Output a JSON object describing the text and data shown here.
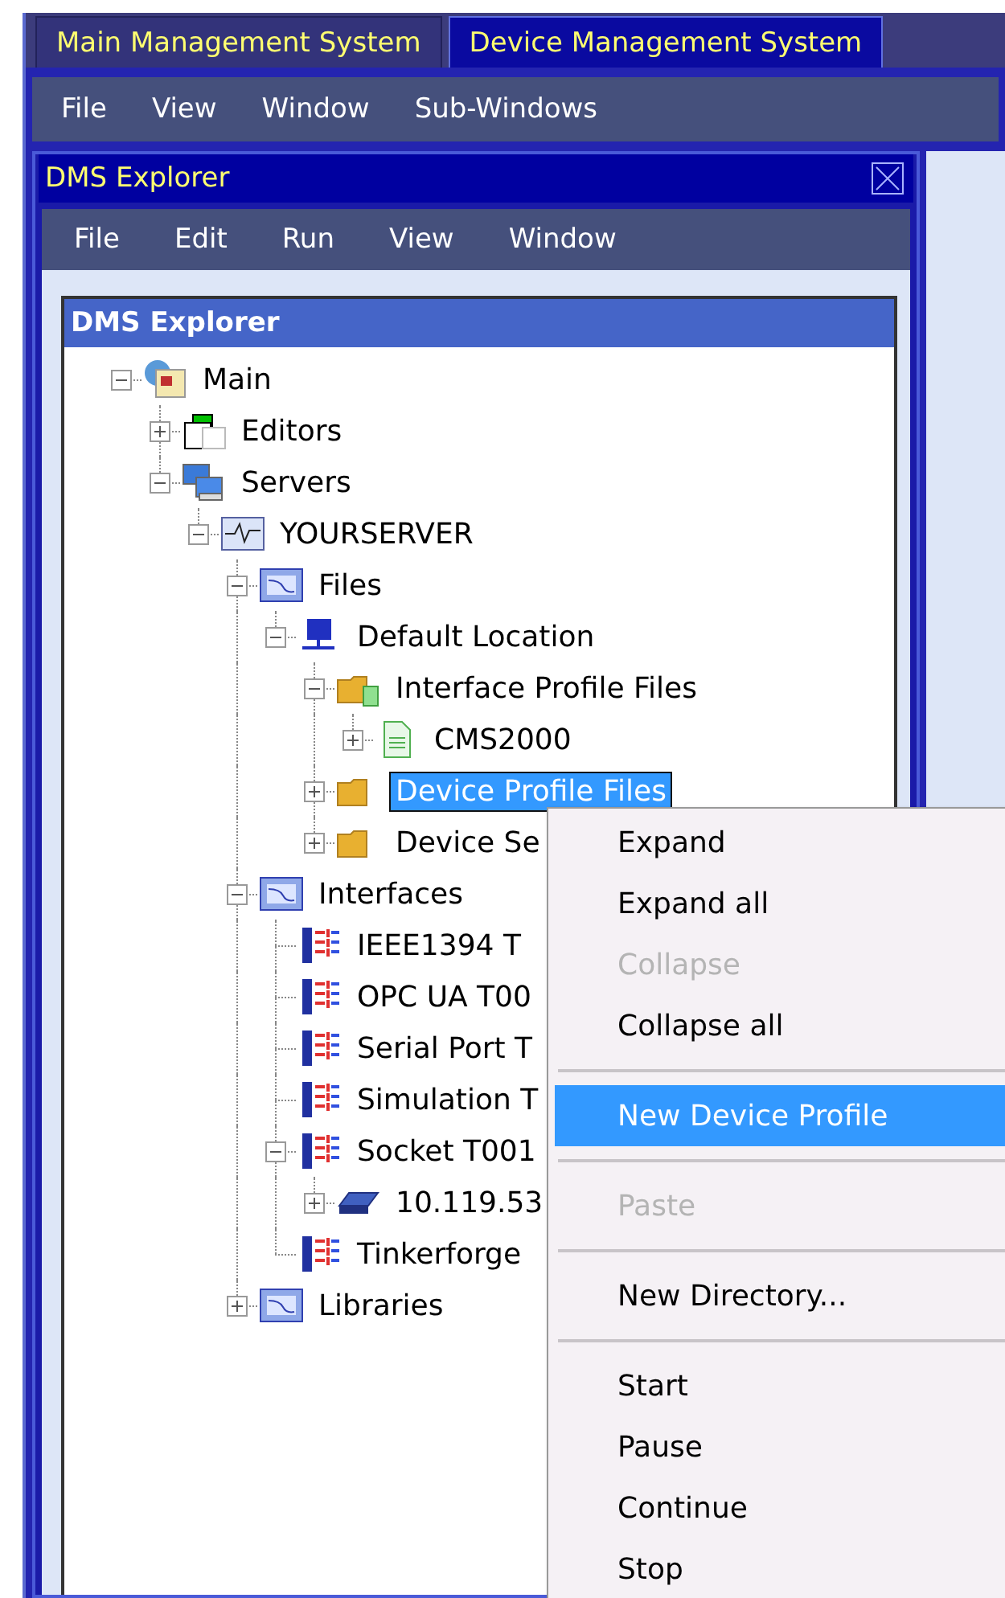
{
  "tabs": [
    {
      "label": "Main Management System",
      "selected": false
    },
    {
      "label": "Device Management System",
      "selected": true
    }
  ],
  "menu_bar": [
    "File",
    "View",
    "Window",
    "Sub-Windows"
  ],
  "explorer": {
    "title": "DMS Explorer",
    "menu": [
      "File",
      "Edit",
      "Run",
      "View",
      "Window"
    ],
    "tree_header": "DMS Explorer",
    "tree": [
      {
        "label": "Main",
        "kind": "root",
        "expanded": true,
        "selected": false,
        "children": [
          {
            "label": "Editors",
            "kind": "editors",
            "expanded": false,
            "selected": false
          },
          {
            "label": "Servers",
            "kind": "servers",
            "expanded": true,
            "selected": false,
            "children": [
              {
                "label": "YOURSERVER",
                "kind": "server",
                "expanded": true,
                "selected": false,
                "children": [
                  {
                    "label": "Files",
                    "kind": "group",
                    "expanded": true,
                    "selected": false,
                    "children": [
                      {
                        "label": "Default Location",
                        "kind": "location",
                        "expanded": true,
                        "selected": false,
                        "children": [
                          {
                            "label": "Interface Profile Files",
                            "kind": "folder-file",
                            "expanded": true,
                            "selected": false,
                            "children": [
                              {
                                "label": "CMS2000",
                                "kind": "file",
                                "expanded": false,
                                "selected": false
                              }
                            ]
                          },
                          {
                            "label": "Device Profile Files",
                            "kind": "folder",
                            "expanded": false,
                            "selected": true
                          },
                          {
                            "label": "Device Se",
                            "kind": "folder",
                            "expanded": false,
                            "selected": false
                          }
                        ]
                      }
                    ]
                  },
                  {
                    "label": "Interfaces",
                    "kind": "group",
                    "expanded": true,
                    "selected": false,
                    "children": [
                      {
                        "label": "IEEE1394 T",
                        "kind": "interface",
                        "selected": false
                      },
                      {
                        "label": "OPC UA T00",
                        "kind": "interface",
                        "selected": false
                      },
                      {
                        "label": "Serial Port T",
                        "kind": "interface",
                        "selected": false
                      },
                      {
                        "label": "Simulation T",
                        "kind": "interface",
                        "selected": false
                      },
                      {
                        "label": "Socket T001",
                        "kind": "interface",
                        "expanded": true,
                        "selected": false,
                        "children": [
                          {
                            "label": "10.119.53",
                            "kind": "device",
                            "expanded": false,
                            "selected": false
                          }
                        ]
                      },
                      {
                        "label": "Tinkerforge",
                        "kind": "interface",
                        "selected": false
                      }
                    ]
                  },
                  {
                    "label": "Libraries",
                    "kind": "group",
                    "expanded": false,
                    "selected": false
                  }
                ]
              }
            ]
          }
        ]
      }
    ]
  },
  "context_menu": [
    {
      "kind": "item",
      "label": "Expand",
      "disabled": false,
      "selected": false
    },
    {
      "kind": "item",
      "label": "Expand all",
      "disabled": false,
      "selected": false
    },
    {
      "kind": "item",
      "label": "Collapse",
      "disabled": true,
      "selected": false
    },
    {
      "kind": "item",
      "label": "Collapse all",
      "disabled": false,
      "selected": false
    },
    {
      "kind": "separator"
    },
    {
      "kind": "item",
      "label": "New Device Profile",
      "disabled": false,
      "selected": true
    },
    {
      "kind": "separator"
    },
    {
      "kind": "item",
      "label": "Paste",
      "disabled": true,
      "selected": false
    },
    {
      "kind": "separator"
    },
    {
      "kind": "item",
      "label": "New Directory...",
      "disabled": false,
      "selected": false
    },
    {
      "kind": "separator"
    },
    {
      "kind": "item",
      "label": "Start",
      "disabled": false,
      "selected": false
    },
    {
      "kind": "item",
      "label": "Pause",
      "disabled": false,
      "selected": false
    },
    {
      "kind": "item",
      "label": "Continue",
      "disabled": false,
      "selected": false
    },
    {
      "kind": "item",
      "label": "Stop",
      "disabled": false,
      "selected": false
    }
  ]
}
